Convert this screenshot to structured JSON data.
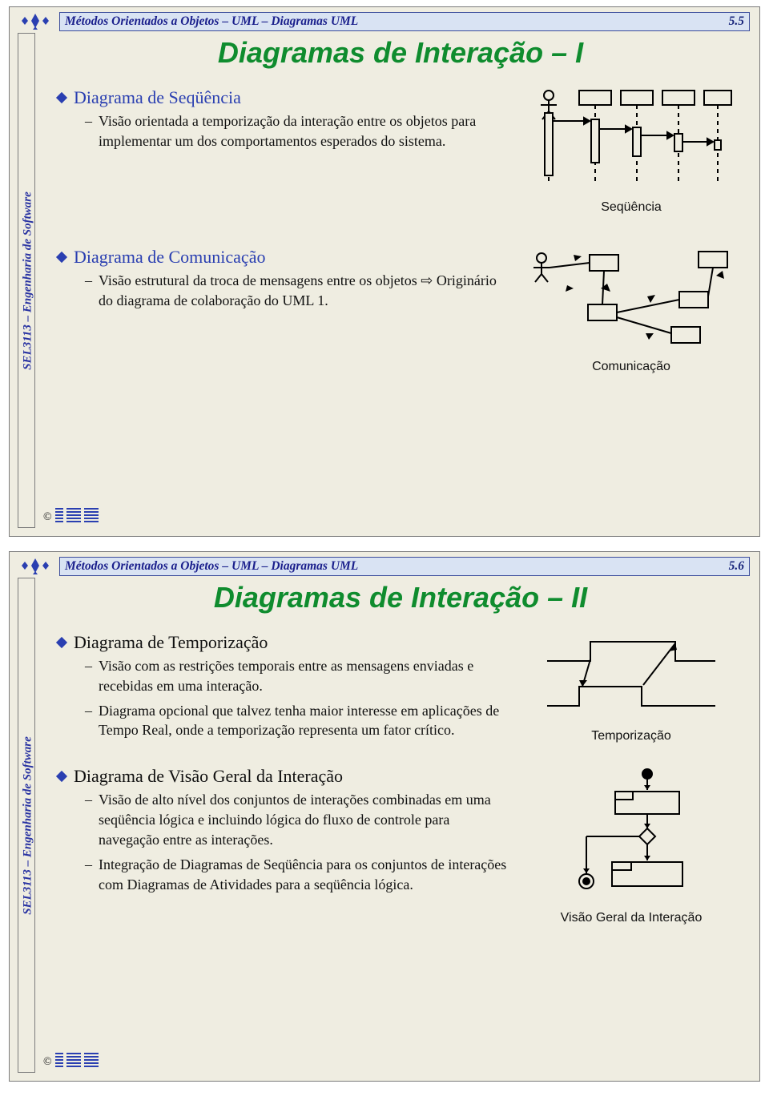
{
  "course_side_label": "SEL3113 – Engenharia de Software",
  "slide5": {
    "header": "Métodos Orientados a Objetos – UML – Diagramas UML",
    "page_num": "5.5",
    "title": "Diagramas de Interação – I",
    "sec1": {
      "head": "Diagrama de Seqüência",
      "bullet1": "Visão orientada a temporização da interação entre os objetos para implementar um dos comportamentos esperados do sistema.",
      "fig_caption": "Seqüência"
    },
    "sec2": {
      "head": "Diagrama de Comunicação",
      "bullet1_pre": "Visão estrutural da troca de mensagens entre os objetos ",
      "bullet1_post": " Originário do diagrama de colaboração do UML 1.",
      "fig_caption": "Comunicação"
    },
    "copyright": "©"
  },
  "slide6": {
    "header": "Métodos Orientados a Objetos – UML – Diagramas UML",
    "page_num": "5.6",
    "title": "Diagramas de Interação – II",
    "sec1": {
      "head": "Diagrama de Temporização",
      "bullet1": "Visão com as restrições temporais entre as mensagens enviadas e recebidas em uma interação.",
      "bullet2": "Diagrama opcional que talvez tenha maior interesse em aplicações de Tempo Real, onde a temporização representa um fator crítico.",
      "fig_caption": "Temporização"
    },
    "sec2": {
      "head": "Diagrama de Visão Geral da Interação",
      "bullet1": "Visão de alto nível dos conjuntos de interações combinadas em uma seqüência lógica e incluindo lógica do fluxo de controle para navegação entre as interações.",
      "bullet2": "Integração de Diagramas de Seqüência para os conjuntos de interações com Diagramas de Atividades para a seqüência lógica.",
      "fig_caption": "Visão Geral da Interação"
    },
    "copyright": "©"
  }
}
